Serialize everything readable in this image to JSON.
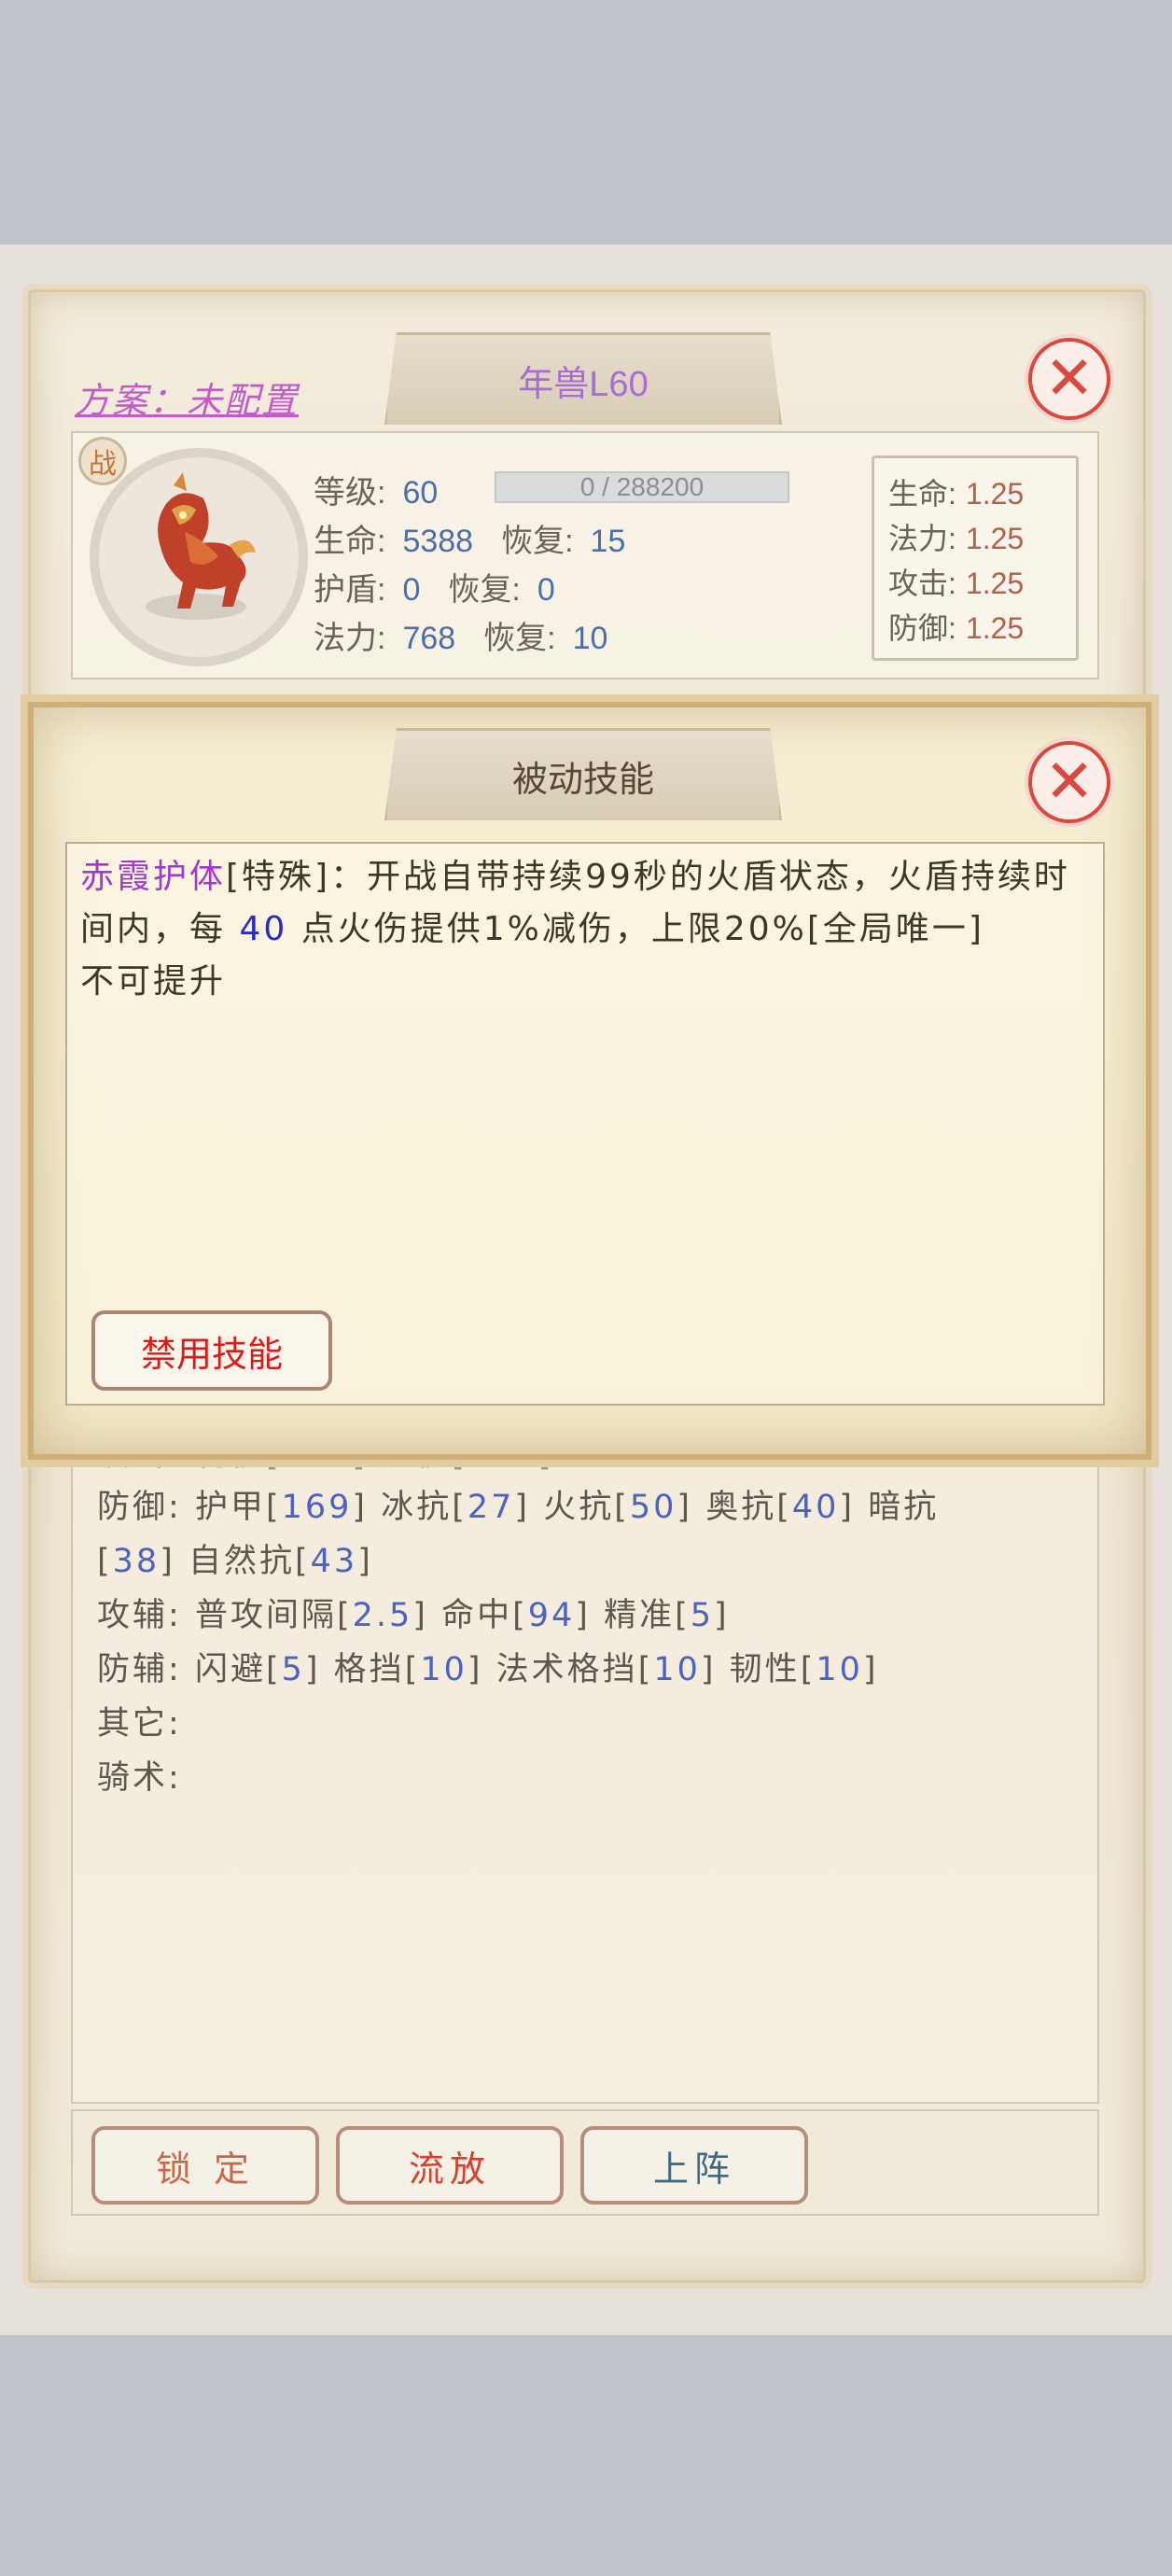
{
  "scheme": {
    "label": "方案：未配置"
  },
  "pet": {
    "name": "年兽L60",
    "badge": "战",
    "level_label": "等级:",
    "level": "60",
    "xp_text": "0 / 288200",
    "xp_fraction": 0,
    "hp_label": "生命:",
    "hp": "5388",
    "hp_regen_label": "恢复:",
    "hp_regen": "15",
    "shield_label": "护盾:",
    "shield": "0",
    "shield_regen_label": "恢复:",
    "shield_regen": "0",
    "mana_label": "法力:",
    "mana": "768",
    "mana_regen_label": "恢复:",
    "mana_regen": "10"
  },
  "growth": [
    {
      "label": "生命:",
      "value": "1.25"
    },
    {
      "label": "法力:",
      "value": "1.25"
    },
    {
      "label": "攻击:",
      "value": "1.25"
    },
    {
      "label": "防御:",
      "value": "1.25"
    }
  ],
  "attributes": {
    "attack": {
      "label": "攻击:",
      "text": "物伤[201] 火伤[207]"
    },
    "defense": {
      "label": "防御:",
      "items": [
        {
          "name": "护甲",
          "value": "169"
        },
        {
          "name": "冰抗",
          "value": "27"
        },
        {
          "name": "火抗",
          "value": "50"
        },
        {
          "name": "奥抗",
          "value": "40"
        },
        {
          "name": "暗抗",
          "value": "38"
        },
        {
          "name": "自然抗",
          "value": "43"
        }
      ]
    },
    "attack_aux": {
      "label": "攻辅:",
      "items": [
        {
          "name": "普攻间隔",
          "value": "2.5"
        },
        {
          "name": "命中",
          "value": "94"
        },
        {
          "name": "精准",
          "value": "5"
        }
      ]
    },
    "defense_aux": {
      "label": "防辅:",
      "items": [
        {
          "name": "闪避",
          "value": "5"
        },
        {
          "name": "格挡",
          "value": "10"
        },
        {
          "name": "法术格挡",
          "value": "10"
        },
        {
          "name": "韧性",
          "value": "10"
        }
      ]
    },
    "other": {
      "label": "其它:"
    },
    "riding": {
      "label": "骑术:"
    }
  },
  "buttons": {
    "lock": "锁 定",
    "exile": "流放",
    "deploy": "上阵"
  },
  "popup": {
    "title": "被动技能",
    "skill_name": "赤霞护体",
    "desc_1": "[特殊]：开战自带持续99秒的火盾状态，火盾持续时间内，每 ",
    "desc_num": "40",
    "desc_2": " 点火伤提供1%减伤，上限20%[全局唯一]",
    "desc_3": "不可提升",
    "disable_button": "禁用技能"
  },
  "colors": {
    "accent_purple": "#a239c8",
    "value_blue": "#4c63c2",
    "danger_red": "#d81c1c"
  },
  "icons": [
    "close-icon",
    "beast-avatar",
    "war-badge"
  ]
}
